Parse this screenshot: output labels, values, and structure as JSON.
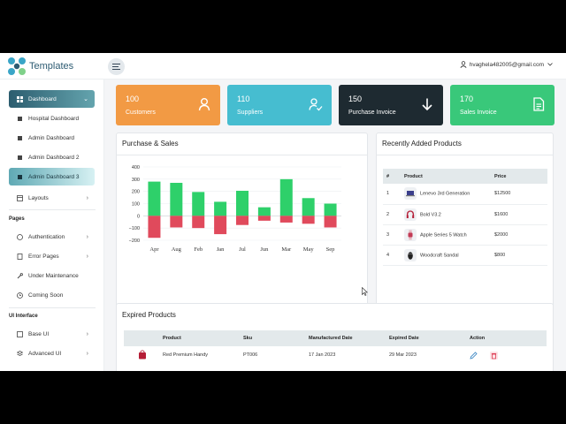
{
  "brand": {
    "name": "Templates"
  },
  "user": {
    "email": "hvaghela482005@gmail.com"
  },
  "sidebar": {
    "items": [
      {
        "label": "Dashboard"
      },
      {
        "label": "Hospital Dashboard"
      },
      {
        "label": "Admin Dashboard"
      },
      {
        "label": "Admin Dashboard 2"
      },
      {
        "label": "Admin Dashboard 3"
      },
      {
        "label": "Layouts"
      }
    ],
    "pages_title": "Pages",
    "pages": [
      {
        "label": "Authentication"
      },
      {
        "label": "Error Pages"
      },
      {
        "label": "Under Maintenance"
      },
      {
        "label": "Coming Soon"
      }
    ],
    "ui_title": "UI Interface",
    "ui": [
      {
        "label": "Base UI"
      },
      {
        "label": "Advanced UI"
      }
    ]
  },
  "stats": [
    {
      "value": "100",
      "label": "Customers",
      "color": "#f29a44",
      "icon": "user-icon"
    },
    {
      "value": "110",
      "label": "Suppliers",
      "color": "#46bdd0",
      "icon": "user-check-icon"
    },
    {
      "value": "150",
      "label": "Purchase Invoice",
      "color": "#1e2a31",
      "icon": "arrow-down-icon"
    },
    {
      "value": "170",
      "label": "Sales Invoice",
      "color": "#39c87a",
      "icon": "document-icon"
    }
  ],
  "purchase_sales": {
    "title": "Purchase & Sales"
  },
  "chart_data": {
    "type": "bar",
    "categories": [
      "Apr",
      "Aug",
      "Feb",
      "Jan",
      "Jul",
      "Jun",
      "Mar",
      "May",
      "Sep"
    ],
    "series": [
      {
        "values": [
          280,
          270,
          195,
          115,
          205,
          70,
          300,
          145,
          100
        ],
        "color": "#2ed06a"
      },
      {
        "values": [
          -180,
          -95,
          -100,
          -150,
          -75,
          -40,
          -55,
          -65,
          -95
        ],
        "color": "#e04a5c"
      }
    ],
    "yticks": [
      "400",
      "300",
      "200",
      "100",
      "0",
      "−100",
      "−200"
    ],
    "ylim": [
      -200,
      400
    ],
    "grid": true
  },
  "recent_products": {
    "title": "Recently Added Products",
    "columns": [
      "#",
      "Product",
      "Price"
    ],
    "rows": [
      {
        "num": "1",
        "product": "Lenevo 3rd Generation",
        "price": "$12500",
        "thumb": "laptop-icon"
      },
      {
        "num": "2",
        "product": "Bold V3.2",
        "price": "$1600",
        "thumb": "headphones-icon"
      },
      {
        "num": "3",
        "product": "Apple Series 5 Watch",
        "price": "$2000",
        "thumb": "watch-icon"
      },
      {
        "num": "4",
        "product": "Woodcraft Sandal",
        "price": "$800",
        "thumb": "sandal-icon"
      }
    ]
  },
  "expired_products": {
    "title": "Expired Products",
    "columns": [
      "Product",
      "Sku",
      "Manufactured Date",
      "Expired Date",
      "Action"
    ],
    "rows": [
      {
        "product": "Red Premium Handy",
        "sku": "PT006",
        "manufactured": "17 Jan 2023",
        "expired": "29 Mar 2023"
      }
    ]
  }
}
